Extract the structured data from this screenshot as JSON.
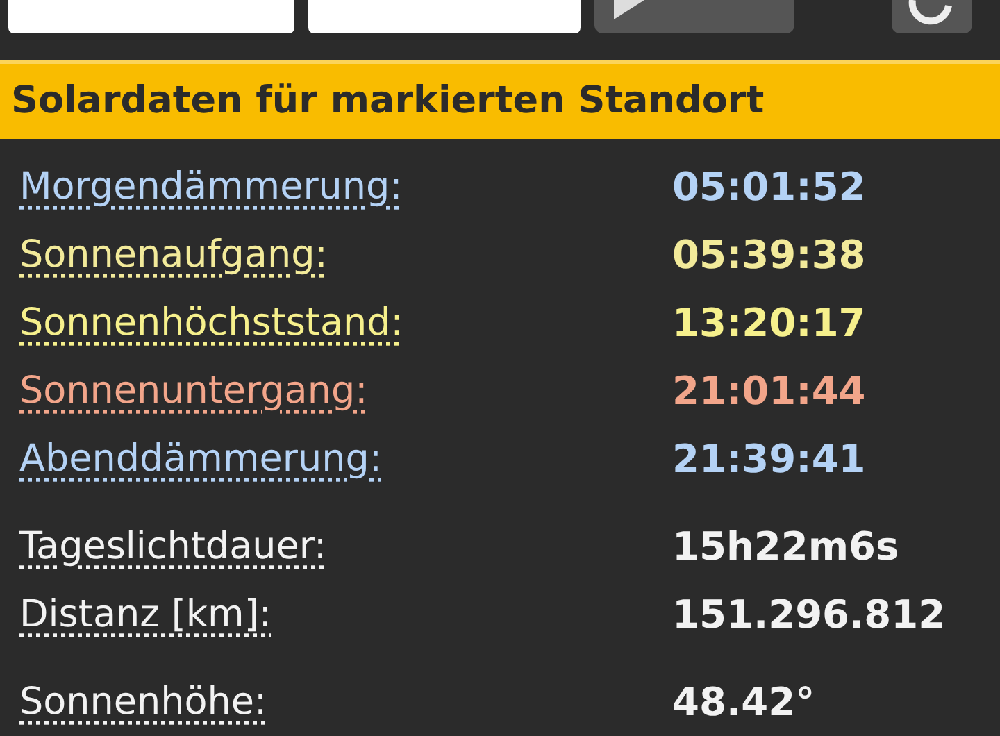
{
  "toolbar": {
    "buttons": [
      {
        "kind": "date-field"
      },
      {
        "kind": "time-field"
      },
      {
        "kind": "live"
      },
      {
        "kind": "refresh"
      }
    ]
  },
  "panel": {
    "title": "Solardaten für markierten Standort",
    "groups": [
      {
        "rows": [
          {
            "label": "Morgendämmerung:",
            "value": "05:01:52",
            "color": "#b4d2f5"
          },
          {
            "label": "Sonnenaufgang:",
            "value": "05:39:38",
            "color": "#f2ea9a"
          },
          {
            "label": "Sonnenhöchststand:",
            "value": "13:20:17",
            "color": "#f6f08c"
          },
          {
            "label": "Sonnenuntergang:",
            "value": "21:01:44",
            "color": "#f2a58a"
          },
          {
            "label": "Abenddämmerung:",
            "value": "21:39:41",
            "color": "#b4d2f5"
          }
        ]
      },
      {
        "rows": [
          {
            "label": "Tageslichtdauer:",
            "value": "15h22m6s",
            "color": "#f2f2f2"
          },
          {
            "label": "Distanz [km]:",
            "value": "151.296.812",
            "color": "#f2f2f2"
          }
        ]
      },
      {
        "rows": [
          {
            "label": "Sonnenhöhe:",
            "value": "48.42°",
            "color": "#f2f2f2"
          }
        ]
      }
    ]
  }
}
